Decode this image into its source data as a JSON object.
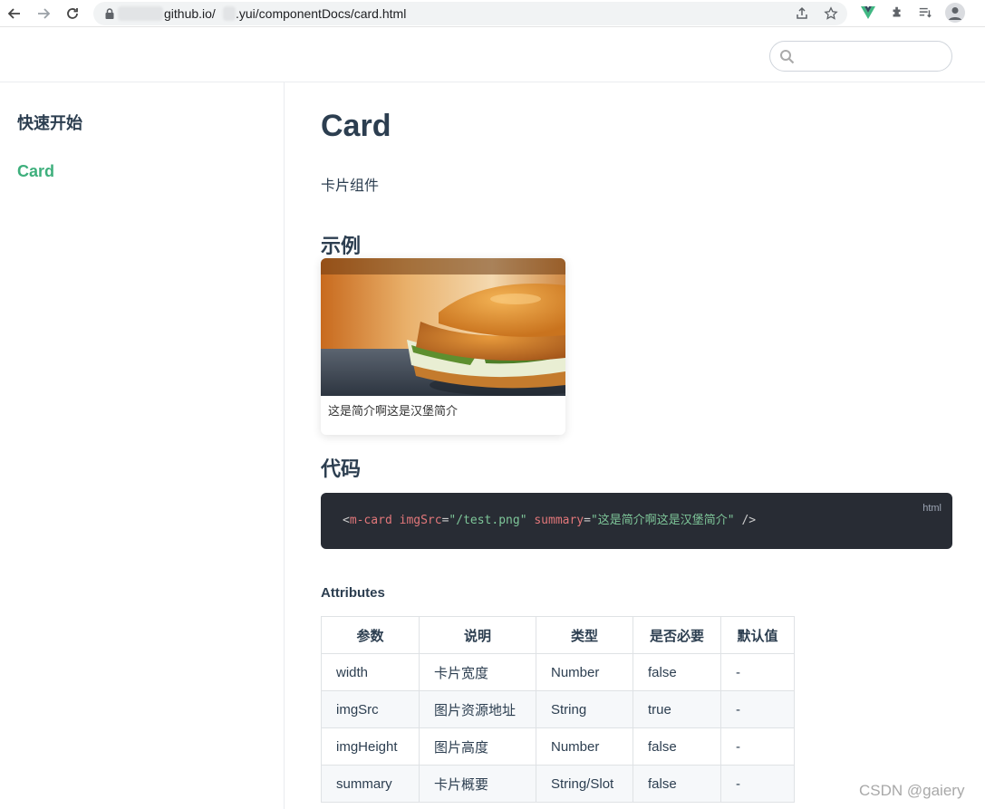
{
  "browser": {
    "url_host": "github.io/",
    "url_path": ".yui/componentDocs/card.html"
  },
  "header": {
    "search_placeholder": ""
  },
  "sidebar": {
    "items": [
      {
        "label": "快速开始"
      },
      {
        "label": "Card"
      }
    ]
  },
  "main": {
    "title": "Card",
    "description": "卡片组件",
    "example_heading": "示例",
    "card_summary": "这是简介啊这是汉堡简介",
    "code_heading": "代码",
    "code": {
      "lang": "html",
      "open": "<",
      "tag": "m-card",
      "attr1": "imgSrc",
      "eq1": "=",
      "val1": "\"/test.png\"",
      "attr2": "summary",
      "eq2": "=",
      "val2": "\"这是简介啊这是汉堡简介\"",
      "close": " />"
    },
    "attributes_heading": "Attributes",
    "table": {
      "headers": [
        "参数",
        "说明",
        "类型",
        "是否必要",
        "默认值"
      ],
      "rows": [
        [
          "width",
          "卡片宽度",
          "Number",
          "false",
          "-"
        ],
        [
          "imgSrc",
          "图片资源地址",
          "String",
          "true",
          "-"
        ],
        [
          "imgHeight",
          "图片高度",
          "Number",
          "false",
          "-"
        ],
        [
          "summary",
          "卡片概要",
          "String/Slot",
          "false",
          "-"
        ]
      ]
    }
  },
  "watermark": "CSDN @gaiery",
  "colors": {
    "accent": "#3eaf7c",
    "text": "#2c3e50",
    "code_bg": "#282c34"
  }
}
